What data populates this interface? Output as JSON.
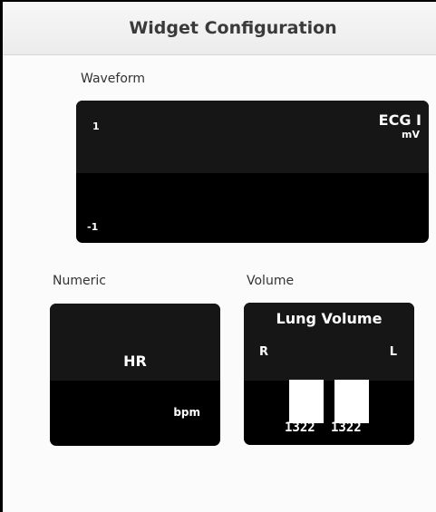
{
  "header": {
    "title": "Widget Configuration"
  },
  "sections": {
    "waveform_label": "Waveform",
    "numeric_label": "Numeric",
    "volume_label": "Volume"
  },
  "waveform": {
    "title": "ECG I",
    "unit": "mV",
    "scale_top": "1",
    "scale_bottom": "-1"
  },
  "numeric": {
    "label": "HR",
    "unit": "bpm"
  },
  "volume": {
    "title": "Lung Volume",
    "right_side": "R",
    "left_side": "L",
    "value_right": "1322",
    "value_left": "1322"
  },
  "colors": {
    "panel_background": "#000000",
    "panel_band": "#161616",
    "text_on_panel": "#ffffff"
  }
}
